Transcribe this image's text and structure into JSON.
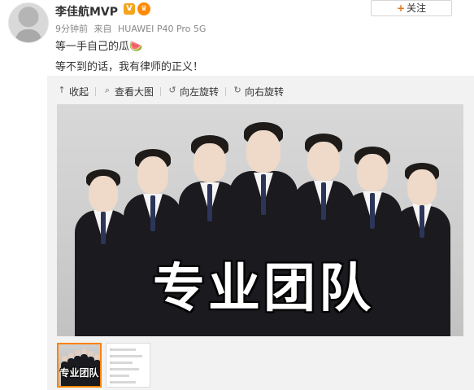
{
  "post": {
    "username": "李佳航MVP",
    "verified_badge": "V",
    "level_badge": "♛",
    "time": "9分钟前",
    "source_prefix": "来自",
    "device": "HUAWEI P40 Pro 5G",
    "text_line1": "等一手自己的瓜🍉",
    "text_line2": "等不到的话，我有律师的正义！"
  },
  "follow_button": {
    "icon": "plus-icon",
    "label": "关注"
  },
  "toolbar": {
    "items": [
      {
        "icon": "collapse-arrow-icon",
        "glyph": "↑",
        "label": "收起"
      },
      {
        "icon": "magnifier-icon",
        "glyph": "⌕",
        "label": "查看大图"
      },
      {
        "icon": "rotate-left-icon",
        "glyph": "↺",
        "label": "向左旋转"
      },
      {
        "icon": "rotate-right-icon",
        "glyph": "↻",
        "label": "向右旋转"
      }
    ]
  },
  "image": {
    "overlay_text": "专业团队"
  },
  "thumbnails": {
    "first_caption": "专业团队"
  },
  "colors": {
    "accent_orange": "#ff8200",
    "panel_bg": "#f2f2f2",
    "text_main": "#333333",
    "text_meta": "#888888"
  }
}
